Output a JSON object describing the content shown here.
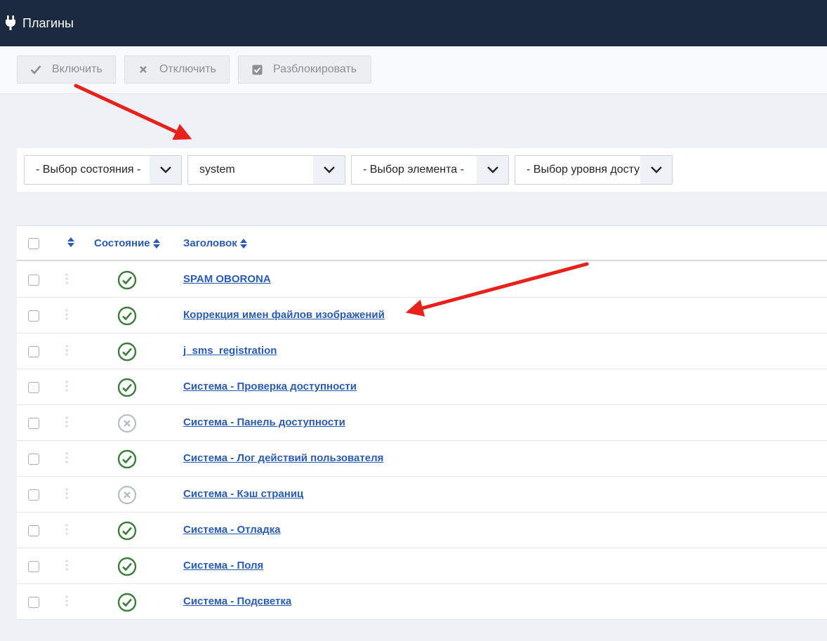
{
  "header": {
    "title": "Плагины"
  },
  "toolbar": {
    "enable_label": "Включить",
    "disable_label": "Отключить",
    "unlock_label": "Разблокировать"
  },
  "filters": {
    "state": "- Выбор состояния -",
    "folder": "system",
    "element": "- Выбор элемента -",
    "access": "- Выбор уровня доступа -"
  },
  "table": {
    "col_state": "Состояние",
    "col_title": "Заголовок",
    "rows": [
      {
        "title": "SPAM OBORONA",
        "enabled": true
      },
      {
        "title": "Коррекция имен файлов изображений",
        "enabled": true
      },
      {
        "title": "j_sms_registration",
        "enabled": true
      },
      {
        "title": "Система - Проверка доступности",
        "enabled": true
      },
      {
        "title": "Система - Панель доступности",
        "enabled": false
      },
      {
        "title": "Система - Лог действий пользователя",
        "enabled": true
      },
      {
        "title": "Система - Кэш страниц",
        "enabled": false
      },
      {
        "title": "Система - Отладка",
        "enabled": true
      },
      {
        "title": "Система - Поля",
        "enabled": true
      },
      {
        "title": "Система - Подсветка",
        "enabled": true
      }
    ]
  },
  "colors": {
    "header_bg": "#1c2a40",
    "link": "#2a5bb5",
    "enabled_green": "#3b7d3b",
    "disabled_gray": "#b9bec4",
    "annotation_arrow": "#e8211b"
  }
}
